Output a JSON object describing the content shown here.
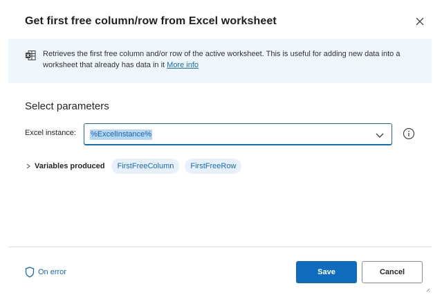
{
  "dialog": {
    "title": "Get first free column/row from Excel worksheet"
  },
  "banner": {
    "icon": "excel-sheet-icon",
    "text": "Retrieves the first free column and/or row of the active worksheet. This is useful for adding new data into a worksheet that already has data in it ",
    "link_label": "More info"
  },
  "parameters": {
    "section_title": "Select parameters",
    "excel_instance": {
      "label": "Excel instance:",
      "value": "%ExcelInstance%"
    }
  },
  "variables": {
    "label": "Variables produced",
    "items": [
      "FirstFreeColumn",
      "FirstFreeRow"
    ]
  },
  "footer": {
    "on_error_label": "On error",
    "save_label": "Save",
    "cancel_label": "Cancel"
  },
  "colors": {
    "accent": "#0f6cbd",
    "banner_bg": "#eff6fc",
    "chip_bg": "#e8f1fb"
  }
}
